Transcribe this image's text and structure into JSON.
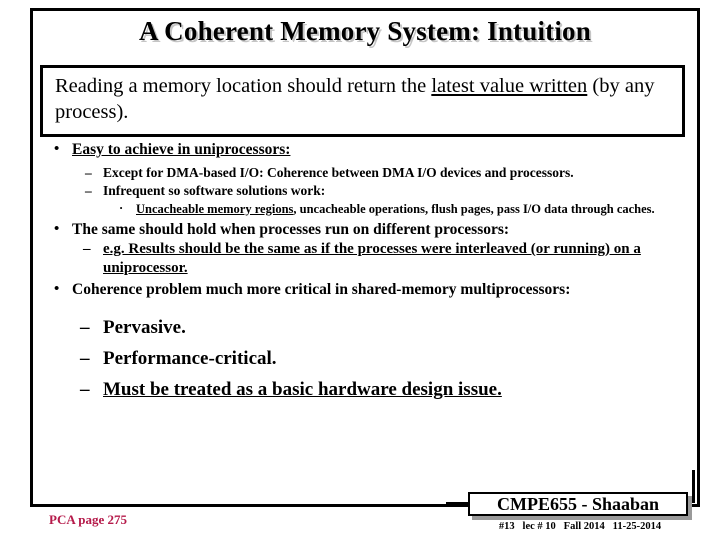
{
  "slide": {
    "title": "A Coherent Memory System:  Intuition",
    "quote": {
      "part1": "Reading a memory location should return the ",
      "underlined1": "latest value written",
      "part2": " (by any process)."
    },
    "bullets": {
      "b1": "Easy to achieve in uniprocessors:",
      "b1s1": "Except for DMA-based I/O:  Coherence between DMA I/O devices and processors.",
      "b1s2": "Infrequent so software solutions work:",
      "b1s2a_underlined": "Uncacheable memory regions",
      "b1s2a_rest": ", uncacheable operations, flush pages, pass I/O data through caches.",
      "b2": "The same should hold when processes run on different processors:",
      "b2s1": "e.g. Results should be the same as if the processes were interleaved (or running) on a uniprocessor.",
      "b3": "Coherence problem much more critical in shared-memory multiprocessors:",
      "b3s1": "Pervasive.",
      "b3s2": "Performance-critical.",
      "b3s3": "Must be treated as a basic hardware design issue."
    },
    "markers": {
      "dot_large": "•",
      "dash": "–",
      "dot_small": "·"
    },
    "footer": {
      "reference": "PCA page 275",
      "course_badge": "CMPE655 - Shaaban",
      "lecture_meta": "#13   lec # 10   Fall 2014   11-25-2014",
      "reference_color": "#b51a4a"
    }
  }
}
